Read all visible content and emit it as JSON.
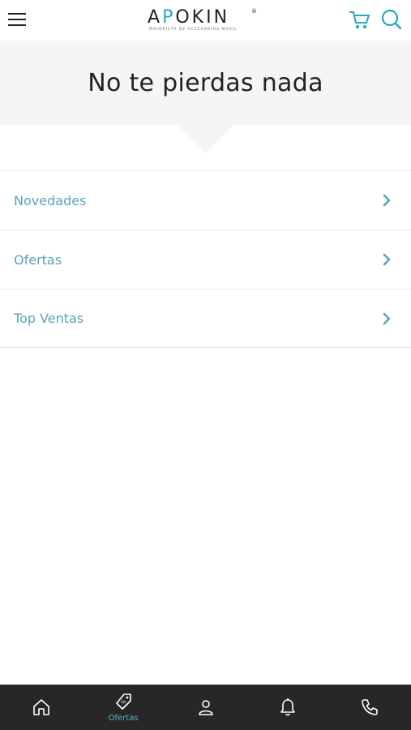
{
  "header": {
    "logo_text_a": "A",
    "logo_text_b": "P",
    "logo_text_c": "OKIN",
    "logo_reg": "®",
    "logo_tagline": "MAYORISTA DE ACCESORIOS MÓVIL"
  },
  "banner": {
    "title": "No te pierdas nada"
  },
  "list": {
    "items": [
      {
        "label": "Novedades"
      },
      {
        "label": "Ofertas"
      },
      {
        "label": "Top Ventas"
      }
    ]
  },
  "bottom_nav": {
    "items": [
      {
        "icon": "home-icon",
        "label": ""
      },
      {
        "icon": "tag-icon",
        "label": "Ofertas"
      },
      {
        "icon": "user-icon",
        "label": ""
      },
      {
        "icon": "bell-icon",
        "label": ""
      },
      {
        "icon": "phone-icon",
        "label": ""
      }
    ]
  },
  "colors": {
    "accent": "#2aa6c4",
    "link": "#5ba3b8",
    "nav_bg": "#272727",
    "banner_bg": "#f5f5f5"
  }
}
